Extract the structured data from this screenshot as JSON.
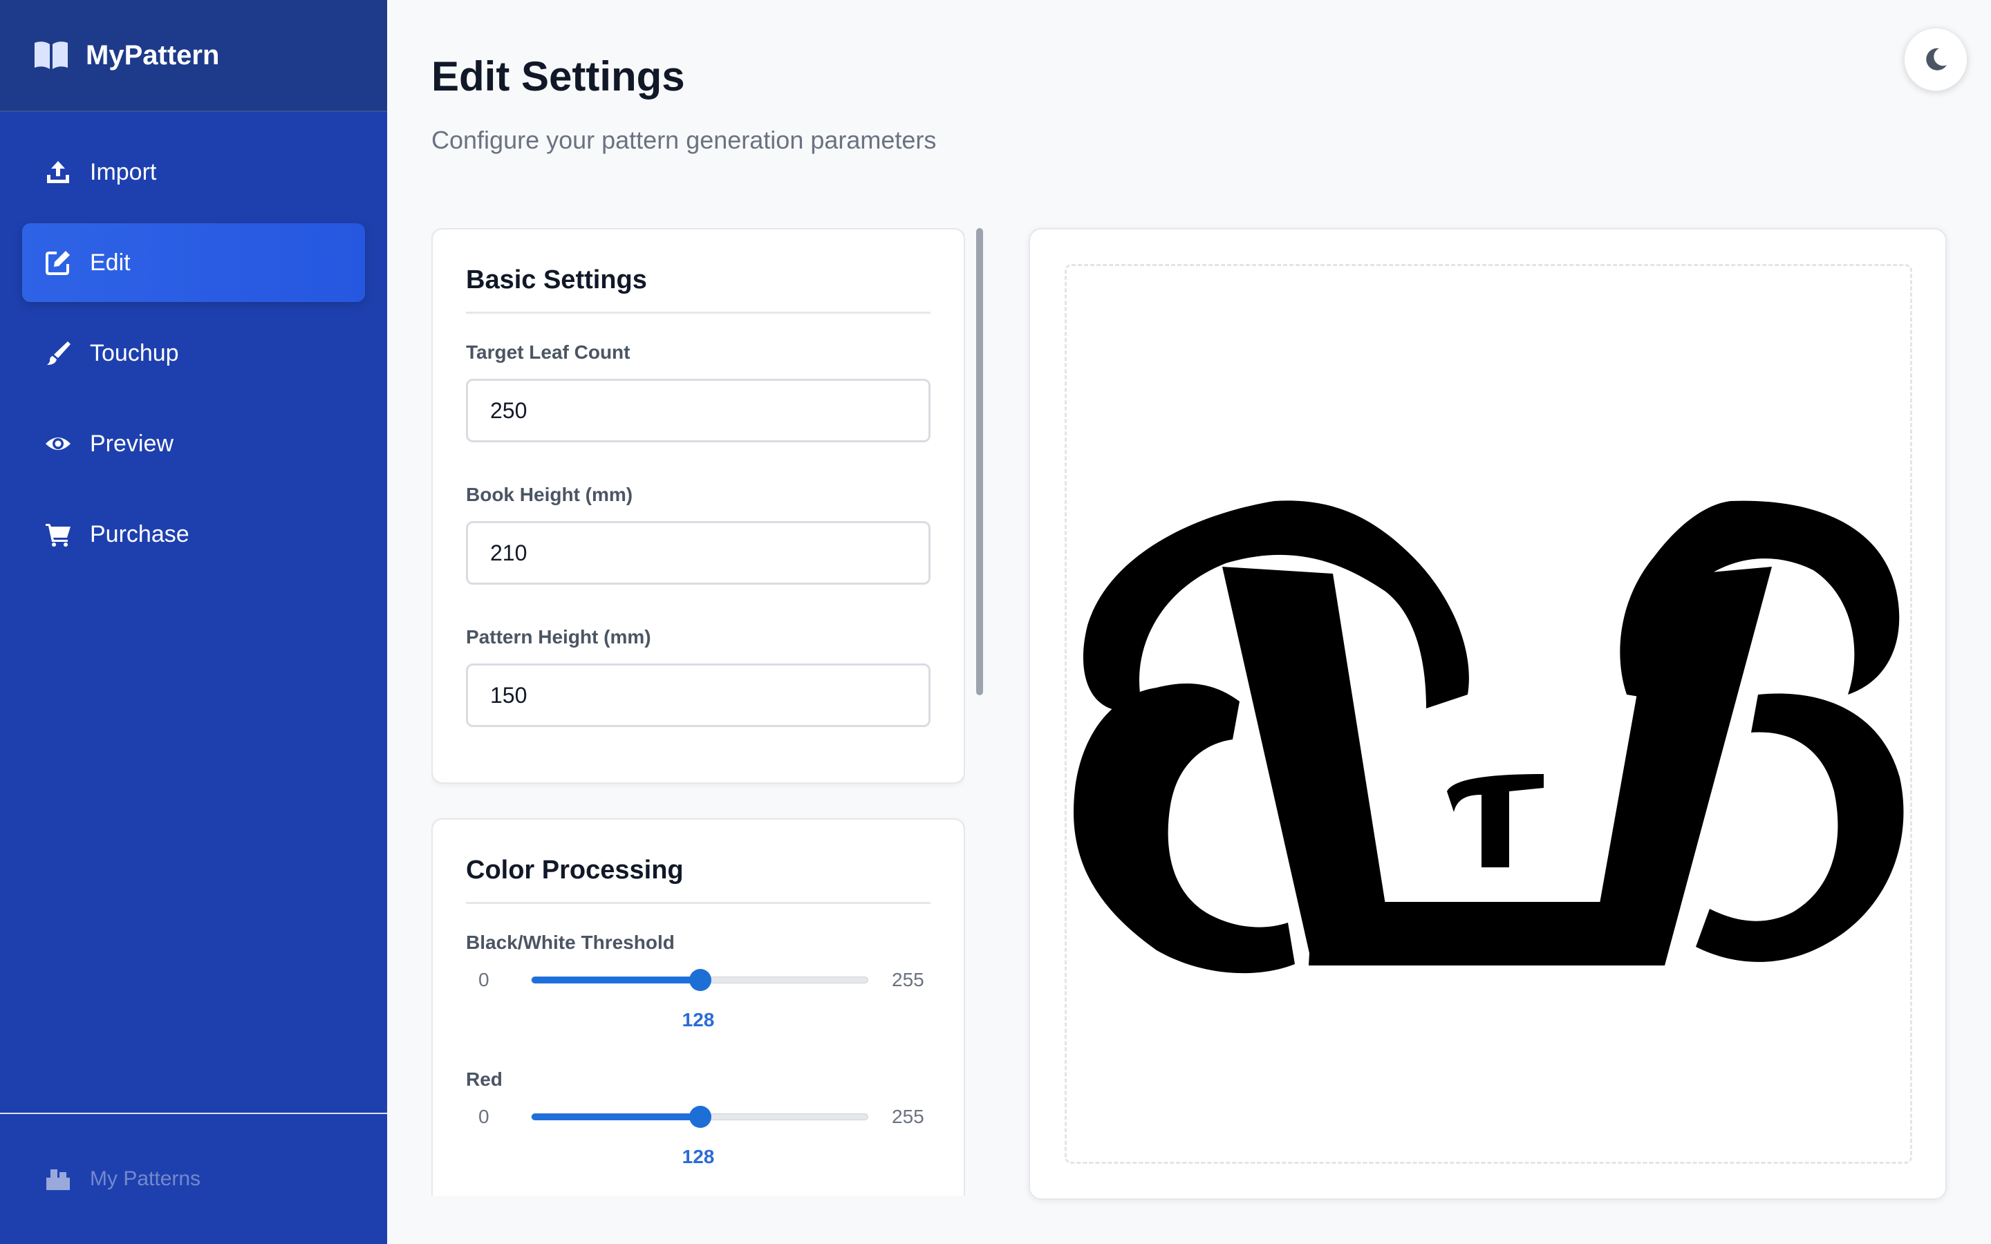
{
  "app": {
    "title": "MyPattern"
  },
  "nav": {
    "items": [
      {
        "label": "Import",
        "icon": "upload-icon"
      },
      {
        "label": "Edit",
        "icon": "edit-icon",
        "active": true
      },
      {
        "label": "Touchup",
        "icon": "brush-icon"
      },
      {
        "label": "Preview",
        "icon": "eye-icon"
      },
      {
        "label": "Purchase",
        "icon": "cart-icon"
      }
    ],
    "footer_label": "My Patterns"
  },
  "page": {
    "title": "Edit Settings",
    "subtitle": "Configure your pattern generation parameters"
  },
  "basic_settings": {
    "title": "Basic Settings",
    "target_leaf_count": {
      "label": "Target Leaf Count",
      "value": "250"
    },
    "book_height": {
      "label": "Book Height (mm)",
      "value": "210"
    },
    "pattern_height": {
      "label": "Pattern Height (mm)",
      "value": "150"
    }
  },
  "color_processing": {
    "title": "Color Processing",
    "threshold": {
      "label": "Black/White Threshold",
      "min": "0",
      "max": "255",
      "value": "128"
    },
    "red": {
      "label": "Red",
      "min": "0",
      "max": "255",
      "value": "128"
    }
  },
  "colors": {
    "sidebar": "#1e40af",
    "accent": "#2563eb",
    "slider": "#1d6fd6"
  }
}
